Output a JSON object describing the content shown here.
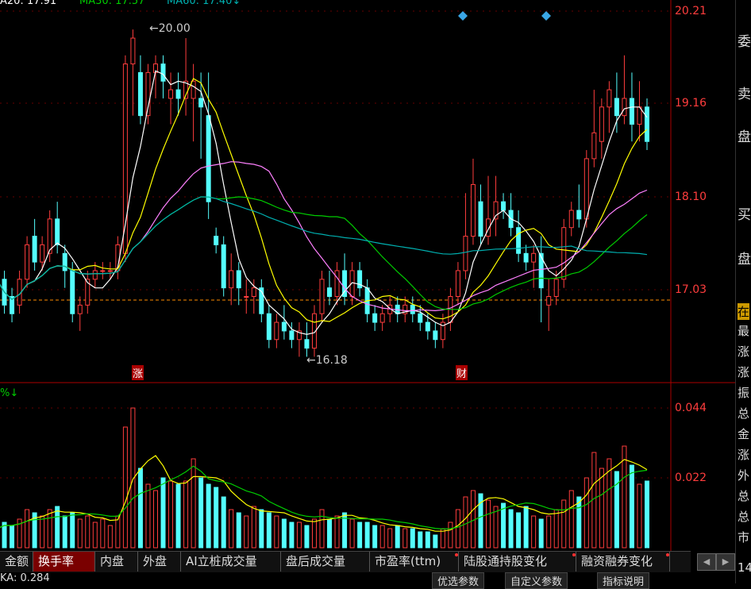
{
  "header": {
    "ma20_text": "A20: 17.91",
    "ma30_text": "MA30: 17.57",
    "ma60_text": "MA60: 17.40",
    "arrow": "↓"
  },
  "price_axis": [
    "20.21",
    "19.16",
    "18.10",
    "17.03"
  ],
  "volume_axis": [
    "0.044",
    "0.022"
  ],
  "annotations": {
    "high_label": "20.00",
    "low_label": "16.18",
    "zhang_marker": "涨",
    "cai_marker": "财",
    "vol_indicator": "%↓"
  },
  "tabs": [
    {
      "label": "金额",
      "active": false,
      "dot": false
    },
    {
      "label": "换手率",
      "active": true,
      "dot": false
    },
    {
      "label": "内盘",
      "active": false,
      "dot": false
    },
    {
      "label": "外盘",
      "active": false,
      "dot": false
    },
    {
      "label": "AI立桩成交量",
      "active": false,
      "dot": false
    },
    {
      "label": "盘后成交量",
      "active": false,
      "dot": false
    },
    {
      "label": "市盈率(ttm)",
      "active": false,
      "dot": true
    },
    {
      "label": "陆股通持股变化",
      "active": false,
      "dot": true
    },
    {
      "label": "融资融券变化",
      "active": false,
      "dot": true
    }
  ],
  "nav": {
    "prev": "◀",
    "next": "▶"
  },
  "right_panel": [
    "委",
    "卖",
    "盘",
    "买",
    "盘",
    "在",
    "最",
    "涨",
    "涨",
    "振",
    "总",
    "金",
    "涨",
    "外",
    "总",
    "总",
    "市",
    "14"
  ],
  "bottom_strip": {
    "left_text": "KA: 0.284",
    "btn1": "优选参数",
    "btn2": "自定义参数",
    "btn3": "指标说明"
  },
  "colors": {
    "up": "#ff3d3d",
    "down": "#54ffff",
    "ma5": "#ffffff",
    "ma10": "#ffff00",
    "ma20": "#ff80ff",
    "ma30": "#00cc00",
    "ma60": "#00b0b0"
  },
  "chart_data": {
    "type": "candlestick",
    "ylim": [
      15.9,
      20.3
    ],
    "candles": [
      [
        17.4,
        17.5,
        17.0,
        17.1
      ],
      [
        17.1,
        17.2,
        16.7,
        16.8
      ],
      [
        16.9,
        17.0,
        16.6,
        16.7
      ],
      [
        16.8,
        17.2,
        16.7,
        17.1
      ],
      [
        17.1,
        17.6,
        17.0,
        17.5
      ],
      [
        17.6,
        17.8,
        17.2,
        17.3
      ],
      [
        17.3,
        17.6,
        17.2,
        17.5
      ],
      [
        17.4,
        17.9,
        17.3,
        17.8
      ],
      [
        17.8,
        18.0,
        17.4,
        17.5
      ],
      [
        17.4,
        17.5,
        17.0,
        17.2
      ],
      [
        17.2,
        17.3,
        16.6,
        16.7
      ],
      [
        16.7,
        16.9,
        16.5,
        16.8
      ],
      [
        16.8,
        17.2,
        16.7,
        17.1
      ],
      [
        17.1,
        17.3,
        17.0,
        17.2
      ],
      [
        17.2,
        17.3,
        17.1,
        17.2
      ],
      [
        17.2,
        17.3,
        17.1,
        17.2
      ],
      [
        17.2,
        17.6,
        17.1,
        17.5
      ],
      [
        17.4,
        19.7,
        17.3,
        19.6
      ],
      [
        19.6,
        20.0,
        19.0,
        19.9
      ],
      [
        19.5,
        19.7,
        18.9,
        19.0
      ],
      [
        19.0,
        19.6,
        18.9,
        19.5
      ],
      [
        19.5,
        19.7,
        19.2,
        19.6
      ],
      [
        19.6,
        19.7,
        19.2,
        19.4
      ],
      [
        19.2,
        19.5,
        18.9,
        19.3
      ],
      [
        19.3,
        19.5,
        19.0,
        19.2
      ],
      [
        19.2,
        19.9,
        19.0,
        19.4
      ],
      [
        19.2,
        19.6,
        18.7,
        19.4
      ],
      [
        19.2,
        19.5,
        18.5,
        19.1
      ],
      [
        19.0,
        19.5,
        17.8,
        18.0
      ],
      [
        17.6,
        17.7,
        17.4,
        17.5
      ],
      [
        17.5,
        17.6,
        16.9,
        17.0
      ],
      [
        17.0,
        17.4,
        16.8,
        17.2
      ],
      [
        17.2,
        17.3,
        16.8,
        17.0
      ],
      [
        16.9,
        17.1,
        16.7,
        16.9
      ],
      [
        16.9,
        17.1,
        16.7,
        17.0
      ],
      [
        17.0,
        17.1,
        16.6,
        16.7
      ],
      [
        16.7,
        16.8,
        16.3,
        16.4
      ],
      [
        16.4,
        16.7,
        16.3,
        16.6
      ],
      [
        16.6,
        16.8,
        16.4,
        16.5
      ],
      [
        16.5,
        16.6,
        16.3,
        16.4
      ],
      [
        16.4,
        16.6,
        16.2,
        16.5
      ],
      [
        16.4,
        16.6,
        16.2,
        16.3
      ],
      [
        16.3,
        16.8,
        16.2,
        16.7
      ],
      [
        16.7,
        17.2,
        16.6,
        17.1
      ],
      [
        17.0,
        17.2,
        16.8,
        16.9
      ],
      [
        16.9,
        17.3,
        16.8,
        17.2
      ],
      [
        17.2,
        17.4,
        16.8,
        16.9
      ],
      [
        16.9,
        17.3,
        16.8,
        17.2
      ],
      [
        17.2,
        17.3,
        16.9,
        17.0
      ],
      [
        17.0,
        17.1,
        16.6,
        16.7
      ],
      [
        16.7,
        16.8,
        16.5,
        16.6
      ],
      [
        16.6,
        16.8,
        16.5,
        16.7
      ],
      [
        16.7,
        16.9,
        16.6,
        16.8
      ],
      [
        16.8,
        16.9,
        16.6,
        16.7
      ],
      [
        16.7,
        16.9,
        16.6,
        16.8
      ],
      [
        16.8,
        16.9,
        16.6,
        16.7
      ],
      [
        16.7,
        16.8,
        16.5,
        16.6
      ],
      [
        16.6,
        16.7,
        16.4,
        16.5
      ],
      [
        16.5,
        16.6,
        16.3,
        16.4
      ],
      [
        16.4,
        16.7,
        16.3,
        16.6
      ],
      [
        16.6,
        17.0,
        16.5,
        16.9
      ],
      [
        16.9,
        17.3,
        16.8,
        17.2
      ],
      [
        17.2,
        18.1,
        17.1,
        17.6
      ],
      [
        17.6,
        18.5,
        17.5,
        18.2
      ],
      [
        18.0,
        18.2,
        17.5,
        17.6
      ],
      [
        17.6,
        18.3,
        17.5,
        17.8
      ],
      [
        17.8,
        18.3,
        17.6,
        18.0
      ],
      [
        18.0,
        18.1,
        17.8,
        17.9
      ],
      [
        17.9,
        18.1,
        17.6,
        17.7
      ],
      [
        17.7,
        17.9,
        17.3,
        17.4
      ],
      [
        17.4,
        17.5,
        17.2,
        17.3
      ],
      [
        17.3,
        17.5,
        17.0,
        17.4
      ],
      [
        17.4,
        17.6,
        16.6,
        17.0
      ],
      [
        16.8,
        17.1,
        16.5,
        16.9
      ],
      [
        16.9,
        17.2,
        16.8,
        17.1
      ],
      [
        17.1,
        17.8,
        17.0,
        17.7
      ],
      [
        17.7,
        18.0,
        17.6,
        17.9
      ],
      [
        17.9,
        18.2,
        17.7,
        17.8
      ],
      [
        17.8,
        18.6,
        17.7,
        18.5
      ],
      [
        18.5,
        19.3,
        18.4,
        18.8
      ],
      [
        18.7,
        19.2,
        18.5,
        19.1
      ],
      [
        19.1,
        19.4,
        18.8,
        19.3
      ],
      [
        19.2,
        19.5,
        18.8,
        19.0
      ],
      [
        19.0,
        19.7,
        18.9,
        19.2
      ],
      [
        19.2,
        19.5,
        18.7,
        18.9
      ],
      [
        18.9,
        19.4,
        18.7,
        19.1
      ],
      [
        19.1,
        19.2,
        18.6,
        18.7
      ]
    ],
    "turnover": [
      0.006,
      0.008,
      0.007,
      0.009,
      0.012,
      0.011,
      0.01,
      0.012,
      0.013,
      0.01,
      0.011,
      0.009,
      0.01,
      0.008,
      0.009,
      0.007,
      0.01,
      0.038,
      0.044,
      0.025,
      0.02,
      0.018,
      0.022,
      0.021,
      0.02,
      0.021,
      0.028,
      0.022,
      0.02,
      0.019,
      0.016,
      0.012,
      0.011,
      0.01,
      0.013,
      0.012,
      0.011,
      0.01,
      0.009,
      0.008,
      0.008,
      0.007,
      0.009,
      0.012,
      0.009,
      0.01,
      0.011,
      0.009,
      0.008,
      0.008,
      0.007,
      0.007,
      0.006,
      0.007,
      0.006,
      0.006,
      0.005,
      0.005,
      0.004,
      0.006,
      0.008,
      0.012,
      0.016,
      0.018,
      0.017,
      0.015,
      0.013,
      0.014,
      0.012,
      0.011,
      0.013,
      0.01,
      0.009,
      0.01,
      0.012,
      0.015,
      0.018,
      0.016,
      0.022,
      0.03,
      0.025,
      0.028,
      0.024,
      0.032,
      0.026,
      0.02,
      0.021
    ]
  }
}
